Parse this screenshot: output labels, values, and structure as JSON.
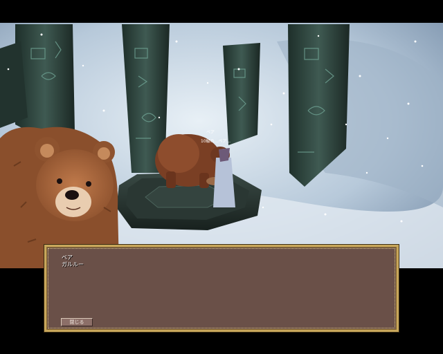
{
  "npc": {
    "name_tag": "ベア",
    "player_label": "10級の...ベア...",
    "creature": "bear"
  },
  "dialog": {
    "speaker": "ベア",
    "message": "ガルルー",
    "close_label": "閉じる"
  },
  "colors": {
    "dialog_bg": "#6a5048",
    "dialog_border": "#c8a75c",
    "sky": "#c9d8e6",
    "pillar": "#2b3d37",
    "bear": "#8a4f2c"
  },
  "icons": [
    "bear-portrait",
    "bear-sprite",
    "player-character"
  ]
}
